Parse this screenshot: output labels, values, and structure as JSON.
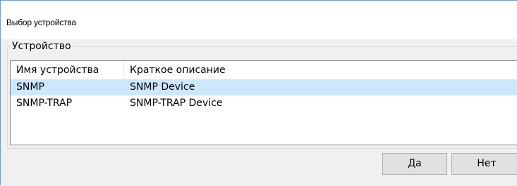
{
  "window": {
    "title": "Выбор устройства"
  },
  "groupbox": {
    "label": "Устройство"
  },
  "listview": {
    "columns": [
      "Имя устройства",
      "Краткое описание"
    ],
    "rows": [
      {
        "name": "SNMP",
        "description": "SNMP Device",
        "selected": true
      },
      {
        "name": "SNMP-TRAP",
        "description": "SNMP-TRAP Device",
        "selected": false
      }
    ]
  },
  "buttons": {
    "yes_label": "Да",
    "no_label": "Нет"
  },
  "colors": {
    "selection": "#cce8ff",
    "window_border": "#6e9ed3",
    "dialog_background": "#f0f0f0",
    "button_face": "#e1e1e1"
  }
}
